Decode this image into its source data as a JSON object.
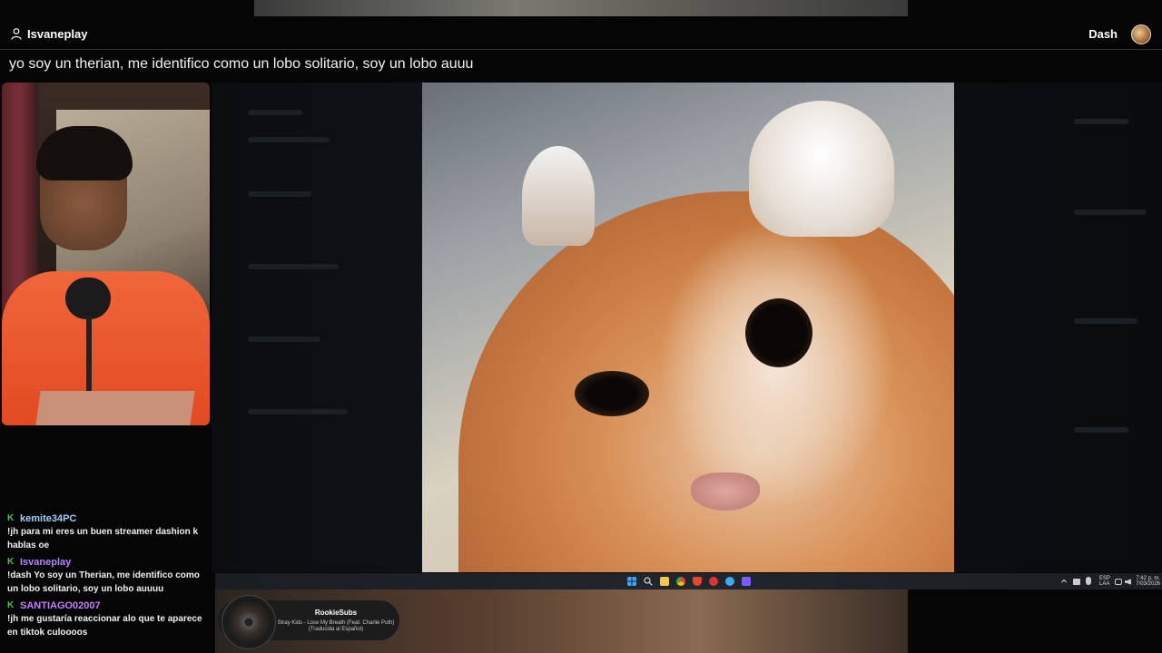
{
  "header": {
    "poster": "Isvaneplay",
    "right_user": "Dash",
    "question": "yo soy un therian, me identifico como un lobo solitario, soy un lobo auuu"
  },
  "chat": {
    "messages": [
      {
        "user": "kemite34PC",
        "color": "#9ecbff",
        "text": "!jh para mi eres un buen streamer dashion k hablas oe"
      },
      {
        "user": "Isvaneplay",
        "color": "#b685ff",
        "text": "!dash Yo soy un Therian, me identifico como un lobo solitario, soy un lobo auuuu"
      },
      {
        "user": "SANTIAGO02007",
        "color": "#c77dff",
        "text": "!jh me gustaría reaccionar alo que te aparece en tiktok culoooos"
      }
    ]
  },
  "music": {
    "title": "RookieSubs",
    "song": "Stray Kids - Lose My Breath (Feat. Charlie Puth) (Traducida al Español)"
  },
  "taskbar": {
    "lang_top": "ESP",
    "lang_bottom": "LAA",
    "time": "7:42 p. m.",
    "date": "7/03/2026"
  },
  "colors": {
    "badge": "#3ecf43",
    "accent_shirt": "#f0663a"
  }
}
